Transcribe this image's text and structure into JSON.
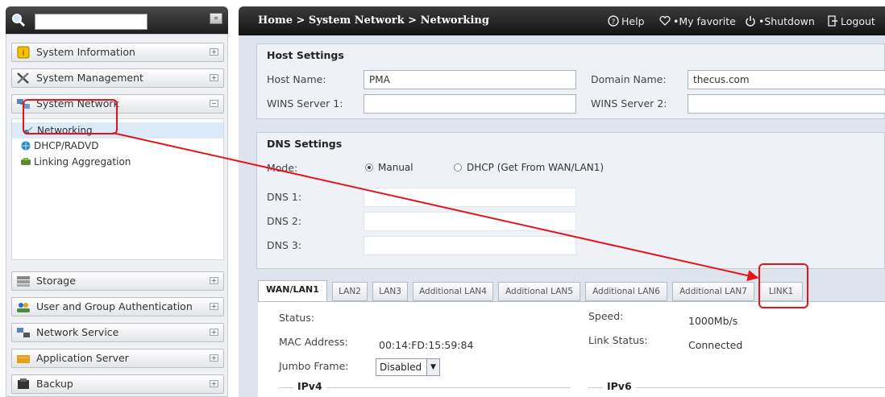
{
  "sidebar": {
    "search_placeholder": "",
    "collapse_glyph": "«",
    "sections_top": [
      {
        "label": "System Information",
        "icon": "info-icon"
      },
      {
        "label": "System Management",
        "icon": "tools-icon"
      },
      {
        "label": "System Network",
        "icon": "network-icon"
      }
    ],
    "network_items": [
      {
        "label": "Networking",
        "icon": "networking-icon"
      },
      {
        "label": "DHCP/RADVD",
        "icon": "globe-icon"
      },
      {
        "label": "Linking Aggregation",
        "icon": "link-aggregation-icon"
      }
    ],
    "sections_bottom": [
      {
        "label": "Storage",
        "icon": "storage-icon"
      },
      {
        "label": "User and Group Authentication",
        "icon": "users-icon"
      },
      {
        "label": "Network Service",
        "icon": "network-service-icon"
      },
      {
        "label": "Application Server",
        "icon": "app-server-icon"
      },
      {
        "label": "Backup",
        "icon": "backup-icon"
      }
    ]
  },
  "header": {
    "breadcrumb": "Home > System Network > Networking",
    "help": "Help",
    "favorite": "My favorite",
    "shutdown": "Shutdown",
    "logout": "Logout"
  },
  "host": {
    "title": "Host Settings",
    "host_name_label": "Host Name:",
    "host_name": "PMA",
    "domain_label": "Domain Name:",
    "domain": "thecus.com",
    "wins1_label": "WINS Server 1:",
    "wins1": "",
    "wins2_label": "WINS Server 2:",
    "wins2": ""
  },
  "dns": {
    "title": "DNS Settings",
    "mode_label": "Mode:",
    "manual": "Manual",
    "dhcp": "DHCP (Get From WAN/LAN1)",
    "selected": "Manual",
    "dns1_label": "DNS 1:",
    "dns2_label": "DNS 2:",
    "dns3_label": "DNS 3:",
    "dns1": "",
    "dns2": "",
    "dns3": ""
  },
  "tabs": [
    "WAN/LAN1",
    "LAN2",
    "LAN3",
    "Additional LAN4",
    "Additional LAN5",
    "Additional LAN6",
    "Additional LAN7",
    "LINK1"
  ],
  "active_tab": "WAN/LAN1",
  "wan": {
    "status_label": "Status:",
    "status": "",
    "mac_label": "MAC Address:",
    "mac": "00:14:FD:15:59:84",
    "jumbo_label": "Jumbo Frame:",
    "jumbo": "Disabled",
    "speed_label": "Speed:",
    "speed": "1000Mb/s",
    "link_label": "Link Status:",
    "link": "Connected",
    "ipv4": "IPv4",
    "ipv6": "IPv6"
  },
  "colors": {
    "annotation": "#e3141b",
    "header_bg": "#1e1e1e",
    "content_bg": "#dde4ee"
  }
}
